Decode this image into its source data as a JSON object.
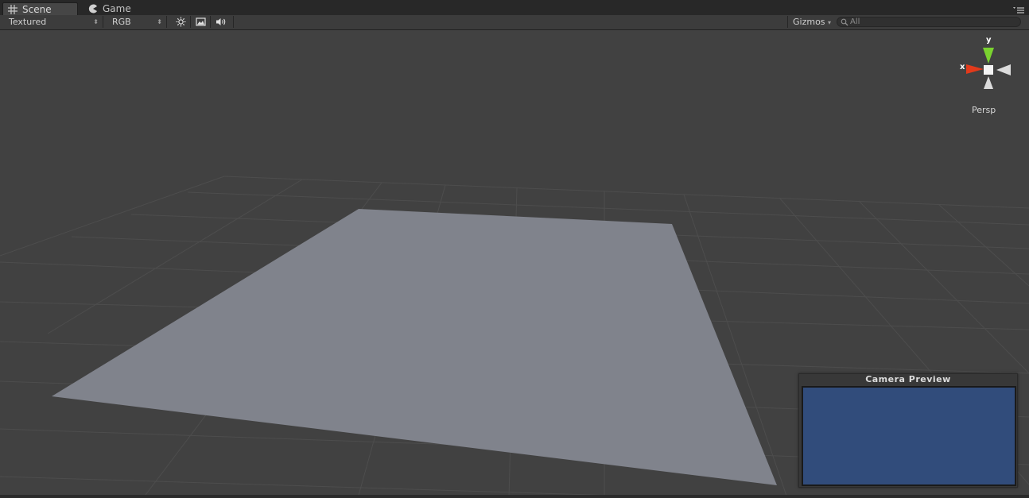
{
  "tabs": [
    {
      "label": "Scene",
      "icon": "grid-icon",
      "active": true
    },
    {
      "label": "Game",
      "icon": "pacman-icon",
      "active": false
    }
  ],
  "toolbar": {
    "render_mode": "Textured",
    "channel": "RGB",
    "lighting_icon": "sun-icon",
    "image_icon": "picture-icon",
    "audio_icon": "speaker-icon",
    "gizmos_label": "Gizmos",
    "gizmos_arrow": "▾",
    "search_placeholder": "All",
    "dropdown_arrows": "⬍"
  },
  "gizmo": {
    "x_label": "x",
    "y_label": "y",
    "projection": "Persp",
    "colors": {
      "x": "#e23a1b",
      "y": "#7ad32f",
      "neutral": "#dcdcdc"
    }
  },
  "camera_preview": {
    "title": "Camera Preview",
    "background_color": "#314c7b"
  },
  "scene": {
    "background": "#414141",
    "grid_color": "#505050",
    "plane_color": "#80838c"
  }
}
